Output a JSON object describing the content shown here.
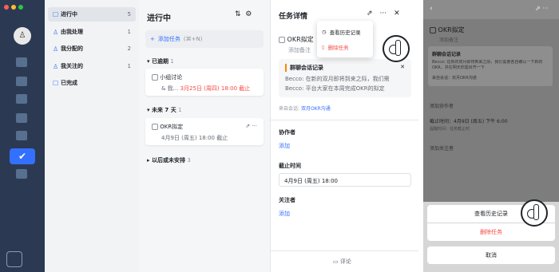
{
  "nav": {
    "items": [
      {
        "label": "进行中",
        "count": "5",
        "icon": "☐"
      },
      {
        "label": "由我处理",
        "count": "1",
        "icon": "♙"
      },
      {
        "label": "我分配的",
        "count": "2",
        "icon": "♙"
      },
      {
        "label": "我关注的",
        "count": "1",
        "icon": "♙"
      },
      {
        "label": "已完成",
        "count": "",
        "icon": "☐"
      }
    ]
  },
  "list": {
    "title": "进行中",
    "add_label": "添加任务",
    "add_hint": "(⌘+N)",
    "groups": [
      {
        "label": "已逾期",
        "count": "1"
      },
      {
        "label": "未来 7 天",
        "count": "1"
      },
      {
        "label": "以后或未安排",
        "count": "3"
      }
    ],
    "task1": {
      "title": "小组讨论",
      "meta": "& 我...",
      "due": "3月25日 (周四) 18:00 截止"
    },
    "task2": {
      "title": "OKR拟定",
      "due": "4月9日 (周五) 18:00 截止"
    }
  },
  "detail": {
    "title": "任务详情",
    "task_title": "OKR拟定",
    "note_placeholder": "添加备注",
    "menu": {
      "history": "查看历史记录",
      "delete": "删除任务"
    },
    "chat": {
      "title": "群聊会话记录",
      "line1": "Becco: 在新的双月即将到来之际，我们需",
      "line2": "Becco: 平台大家在本周完成OKR的拟定"
    },
    "source_label": "来自会话:",
    "source_link": "双月OKR沟通",
    "collab_label": "协作者",
    "collab_add": "添加",
    "due_label": "截止时间",
    "due_value": "4月9日 (周五) 18:00",
    "follow_label": "关注者",
    "follow_add": "添加",
    "comment": "评论"
  },
  "phone": {
    "task_title": "OKR拟定",
    "note": "添加备注",
    "chat_title": "群聊会话记录",
    "chat_text": "Becco: 在新的双月即将到来之际，我们需要各自确认一下新的 OKR，并在明天你需对齐一下",
    "source": "来自会话：双月OKR沟通",
    "collab": "添加协作者",
    "due": "截止时间：4月9日 (周五) 下午 6:00",
    "due_sub": "提醒时间：任务截止时",
    "follow": "添加关注者",
    "sheet": {
      "history": "查看历史记录",
      "delete": "删除任务",
      "cancel": "取消"
    }
  },
  "colors": {
    "accent": "#3370ff",
    "danger": "#f54a45",
    "rail": "#2b3a52"
  }
}
